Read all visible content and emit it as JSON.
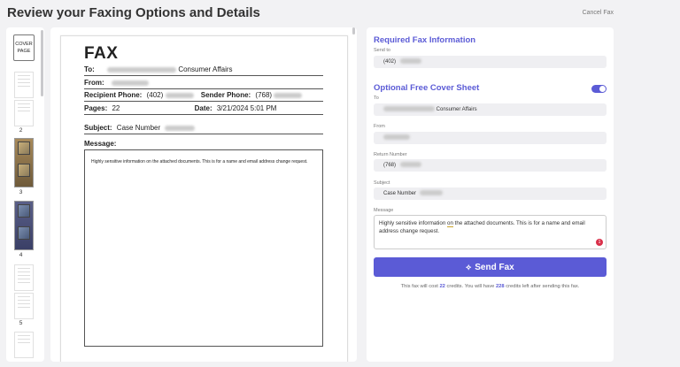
{
  "page": {
    "title": "Review your Faxing Options and Details",
    "cancel_label": "Cancel Fax"
  },
  "thumbnails": {
    "cover_label": "COVER PAGE",
    "page_numbers": [
      "2",
      "3",
      "4",
      "5"
    ]
  },
  "preview": {
    "heading": "FAX",
    "to_label": "To:",
    "to_value": "Consumer Affairs",
    "from_label": "From:",
    "recipient_phone_label": "Recipient Phone:",
    "recipient_phone_value": "(402)",
    "sender_phone_label": "Sender Phone:",
    "sender_phone_value": "(768)",
    "pages_label": "Pages:",
    "pages_value": "22",
    "date_label": "Date:",
    "date_value": "3/21/2024 5:01 PM",
    "subject_label": "Subject:",
    "subject_value": "Case Number",
    "message_label": "Message:",
    "message_text": "Highly sensitive information on the attached documents. This is for a name and email address change request."
  },
  "form": {
    "required_title": "Required Fax Information",
    "send_to_label": "Send to",
    "send_to_value": "(402)",
    "cover_title": "Optional Free Cover Sheet",
    "cover_enabled": true,
    "to_label": "To",
    "to_value": "Consumer Affairs",
    "from_label": "From",
    "return_label": "Return Number",
    "return_value": "(768)",
    "subject_label": "Subject",
    "subject_value": "Case Number",
    "message_label": "Message",
    "message_pre": "Highly sensitive information ",
    "message_on": "on",
    "message_post": " the attached documents. This is for a name and email address change request.",
    "badge_count": "1",
    "send_label": "Send Fax",
    "send_icon": "send-diamond-icon",
    "cost_pre": "This fax will cost ",
    "cost_credits": "22",
    "cost_mid": " credits. You will have ",
    "remaining_credits": "228",
    "cost_post": " credits left after sending this fax."
  },
  "colors": {
    "accent": "#5b5bd6",
    "badge": "#d9304a"
  }
}
